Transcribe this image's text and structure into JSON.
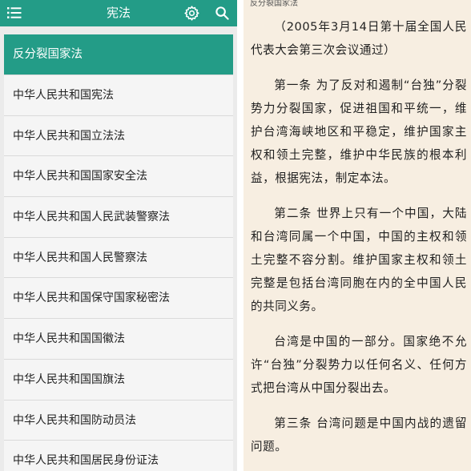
{
  "app": {
    "title": "宪法",
    "icons": {
      "menu": "menu-icon",
      "settings": "gear-icon",
      "search": "search-icon"
    },
    "colors": {
      "accent": "#239c87",
      "reader_bg": "#f7eee1",
      "list_bg": "#f5f5f5"
    }
  },
  "law_list": {
    "items": [
      {
        "label": "反分裂国家法",
        "active": true
      },
      {
        "label": "中华人民共和国宪法"
      },
      {
        "label": "中华人民共和国立法法"
      },
      {
        "label": "中华人民共和国国家安全法"
      },
      {
        "label": "中华人民共和国人民武装警察法"
      },
      {
        "label": "中华人民共和国人民警察法"
      },
      {
        "label": "中华人民共和国保守国家秘密法"
      },
      {
        "label": "中华人民共和国国徽法"
      },
      {
        "label": "中华人民共和国国旗法"
      },
      {
        "label": "中华人民共和国防动员法"
      },
      {
        "label": "中华人民共和国居民身份证法"
      }
    ]
  },
  "reader": {
    "doc_title": "反分裂国家法",
    "paragraphs": [
      "（2005年3月14日第十届全国人民代表大会第三次会议通过）",
      "第一条 为了反对和遏制“台独”分裂势力分裂国家，促进祖国和平统一，维护台湾海峡地区和平稳定，维护国家主权和领土完整，维护中华民族的根本利益，根据宪法，制定本法。",
      "第二条 世界上只有一个中国，大陆和台湾同属一个中国，中国的主权和领土完整不容分割。维护国家主权和领土完整是包括台湾同胞在内的全中国人民的共同义务。",
      "台湾是中国的一部分。国家绝不允许“台独”分裂势力以任何名义、任何方式把台湾从中国分裂出去。",
      "第三条 台湾问题是中国内战的遗留问题。"
    ]
  }
}
